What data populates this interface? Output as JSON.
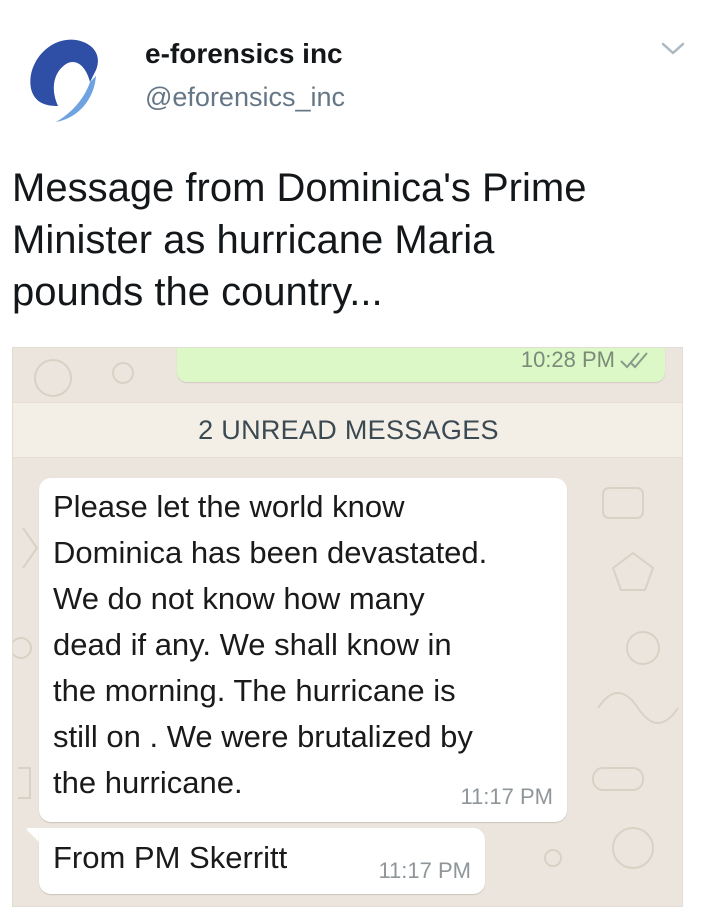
{
  "tweet": {
    "author_name": "e-forensics inc",
    "author_handle": "@eforensics_inc",
    "avatar_icon": "eforensics-logo-icon",
    "menu_icon": "chevron-down-icon",
    "text": "Message from Dominica's Prime\nMinister as hurricane Maria\npounds the country..."
  },
  "chat": {
    "sent_message_time": "10:28 PM",
    "sent_status_icon": "double-check-icon",
    "unread_banner": "2 UNREAD MESSAGES",
    "messages": [
      {
        "text": "Please let the world know\nDominica  has been devastated.\nWe do not know how many\ndead if any. We shall know in\nthe morning. The hurricane is\nstill on . We were brutalized by\nthe hurricane.",
        "time": "11:17 PM"
      },
      {
        "text": "From PM Skerritt",
        "time": "11:17 PM"
      }
    ]
  },
  "colors": {
    "avatar_blue": "#2f4fa7",
    "sent_bubble": "#dcf8c6",
    "chat_background": "#ece5dd",
    "handle_gray": "#657786"
  }
}
